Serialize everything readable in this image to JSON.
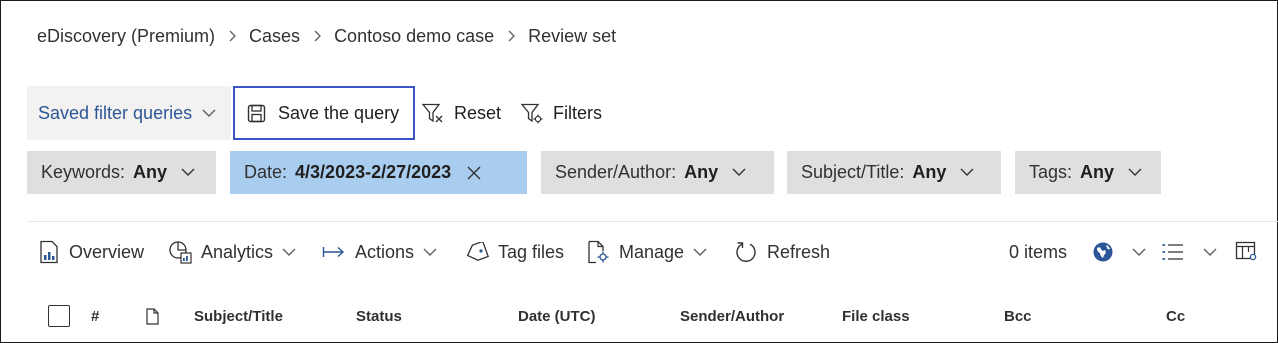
{
  "breadcrumb": {
    "items": [
      "eDiscovery (Premium)",
      "Cases",
      "Contoso demo case",
      "Review set"
    ]
  },
  "query_toolbar": {
    "saved_filter_queries": "Saved filter queries",
    "save_query": "Save the query",
    "reset": "Reset",
    "filters": "Filters"
  },
  "filters": {
    "keywords": {
      "label": "Keywords:",
      "value": "Any"
    },
    "date": {
      "label": "Date:",
      "value": "4/3/2023-2/27/2023"
    },
    "sender": {
      "label": "Sender/Author:",
      "value": "Any"
    },
    "subject": {
      "label": "Subject/Title:",
      "value": "Any"
    },
    "tags": {
      "label": "Tags:",
      "value": "Any"
    }
  },
  "commands": {
    "overview": "Overview",
    "analytics": "Analytics",
    "actions": "Actions",
    "tag_files": "Tag files",
    "manage": "Manage",
    "refresh": "Refresh",
    "item_count": "0 items"
  },
  "table": {
    "columns": [
      "#",
      "Subject/Title",
      "Status",
      "Date (UTC)",
      "Sender/Author",
      "File class",
      "Bcc",
      "Cc"
    ]
  },
  "colors": {
    "accent_border": "#3a54c6",
    "link_blue": "#2b5797",
    "active_filter": "#a9cdee",
    "pill_bg": "#e1dfdd"
  },
  "icons": [
    "chevron-right-icon",
    "chevron-down-icon",
    "save-icon",
    "filter-reset-icon",
    "filter-settings-icon",
    "close-icon",
    "overview-icon",
    "analytics-icon",
    "actions-arrow-icon",
    "tag-icon",
    "manage-file-icon",
    "refresh-icon",
    "globe-icon",
    "list-options-icon",
    "column-settings-icon",
    "document-icon"
  ]
}
